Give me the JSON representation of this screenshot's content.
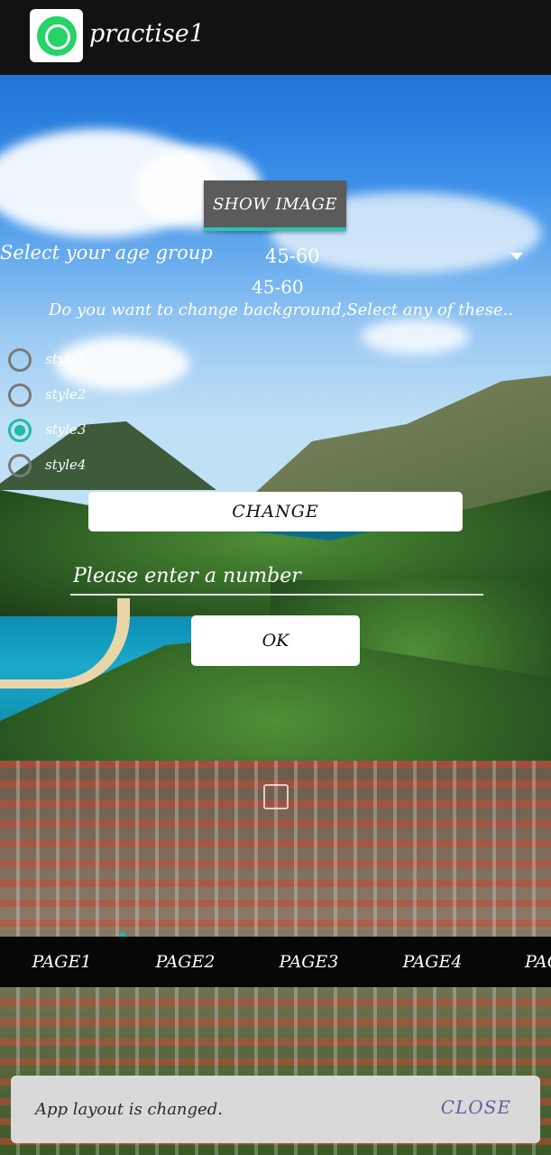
{
  "app": {
    "title": "practise1"
  },
  "controls": {
    "show_image_label": "SHOW IMAGE",
    "age_label": "Select your age group",
    "age_selected": "45-60",
    "age_value": "45-60",
    "bg_question": "Do you want to change background,Select any of these..",
    "styles": [
      {
        "label": "style1",
        "checked": false
      },
      {
        "label": "style2",
        "checked": false
      },
      {
        "label": "style3",
        "checked": true
      },
      {
        "label": "style4",
        "checked": false
      }
    ],
    "change_label": "CHANGE",
    "number_placeholder": "Please enter a number",
    "ok_label": "OK"
  },
  "tabs": [
    "PAGE1",
    "PAGE2",
    "PAGE3",
    "PAGE4",
    "PAG"
  ],
  "snackbar": {
    "text": "App layout is changed.",
    "action": "CLOSE"
  },
  "colors": {
    "accent": "#1fbba6",
    "snack_action": "#6d5a98",
    "appbar": "#121212"
  }
}
